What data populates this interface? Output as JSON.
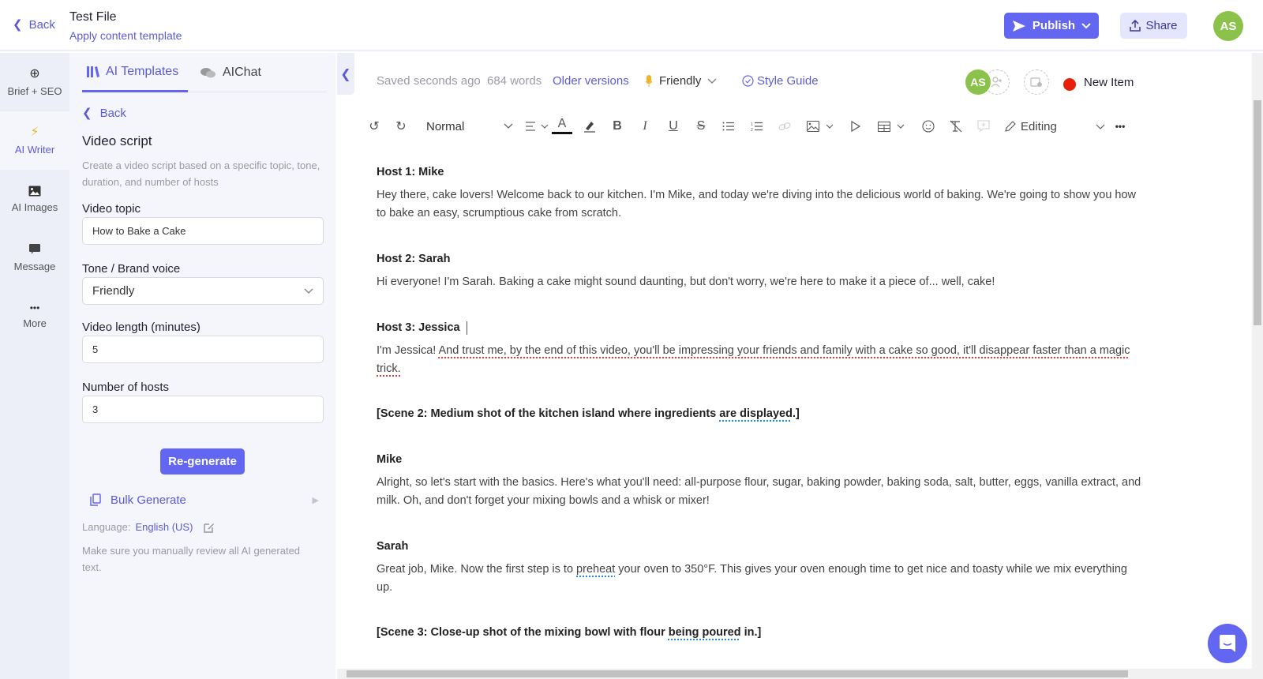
{
  "header": {
    "back_label": "Back",
    "file_title": "Test File",
    "subtitle_link": "Apply content template",
    "publish_label": "Publish",
    "share_label": "Share",
    "avatar_initials": "AS",
    "accent_color": "#6366f1",
    "avatar_color": "#8bc34a"
  },
  "leftnav": {
    "items": [
      {
        "label": "Brief + SEO",
        "icon": "crosshair-icon"
      },
      {
        "label": "AI Writer",
        "icon": "lightning-icon",
        "active": true
      },
      {
        "label": "AI Images",
        "icon": "image-icon"
      },
      {
        "label": "Message",
        "icon": "message-icon"
      },
      {
        "label": "More",
        "icon": "more-icon"
      }
    ]
  },
  "panel": {
    "tabs": [
      {
        "label": "AI Templates",
        "active": true
      },
      {
        "label": "AIChat",
        "active": false
      }
    ],
    "back_label": "Back",
    "title": "Video script",
    "description": "Create a video script based on a specific topic, tone, duration, and number of hosts",
    "fields": {
      "topic": {
        "label": "Video topic",
        "value": "How to Bake a Cake"
      },
      "tone": {
        "label": "Tone / Brand voice",
        "value": "Friendly"
      },
      "length": {
        "label": "Video length (minutes)",
        "value": "5"
      },
      "hosts": {
        "label": "Number of hosts",
        "value": "3"
      }
    },
    "regenerate_label": "Re-generate",
    "bulk_label": "Bulk Generate",
    "language_prefix": "Language:",
    "language_value": "English (US)",
    "note": "Make sure you manually review all AI generated text."
  },
  "editor_meta": {
    "saved": "Saved seconds ago",
    "word_count": "684 words",
    "older_versions": "Older versions",
    "tone": "Friendly",
    "style_guide": "Style Guide",
    "collaborator_initials": "AS",
    "status_label": "New Item",
    "status_color": "#e8200b"
  },
  "toolbar": {
    "text_style": "Normal",
    "mode": "Editing"
  },
  "document": {
    "blocks": [
      {
        "speaker": "Host 1: Mike",
        "text": "Hey there, cake lovers! Welcome back to our kitchen. I'm Mike, and today we're diving into the delicious world of baking. We're going to show you how to bake an easy, scrumptious cake from scratch."
      },
      {
        "speaker": "Host 2: Sarah",
        "text": "Hi everyone! I'm Sarah. Baking a cake might sound daunting, but don't worry, we're here to make it a piece of... well, cake!"
      },
      {
        "speaker": "Host 3: Jessica",
        "text_pre": "I'm Jessica! ",
        "text_flagged": "And trust me, by the end of this video, you'll be impressing your friends and family with a cake so good, it'll disappear faster than a magic trick."
      },
      {
        "scene_pre": "[Scene 2: Medium shot of the kitchen island where ingredients ",
        "scene_flag": "are displayed",
        "scene_post": ".]"
      },
      {
        "speaker": "Mike",
        "text": "Alright, so let's start with the basics. Here's what you'll need: all-purpose flour, sugar, baking powder, baking soda, salt, butter, eggs, vanilla extract, and milk. Oh, and don't forget your mixing bowls and a whisk or mixer!"
      },
      {
        "speaker": "Sarah",
        "text_pre": "Great job, Mike. Now the first step is to ",
        "text_flag": "preheat",
        "text_post": " your oven to 350°F. This gives your oven enough time to get nice and toasty while we mix everything up."
      },
      {
        "scene_pre": "[Scene 3: Close-up shot of the mixing bowl with flour ",
        "scene_flag": "being poured",
        "scene_post": " in.]"
      }
    ]
  }
}
